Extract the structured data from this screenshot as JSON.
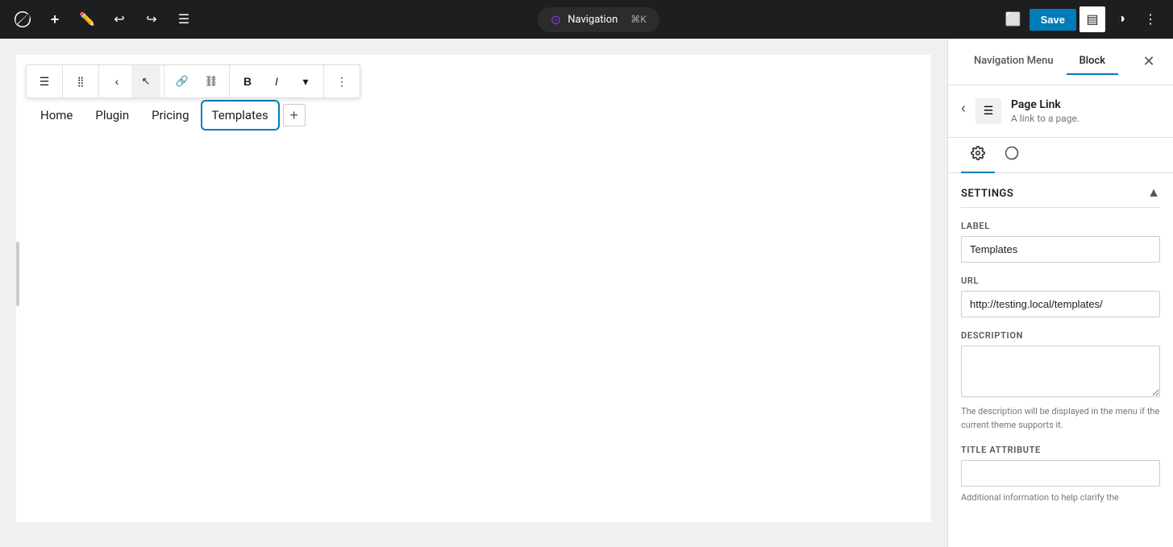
{
  "topbar": {
    "add_label": "+",
    "nav_title": "Navigation",
    "shortcut": "⌘K",
    "save_label": "Save"
  },
  "nav_items": [
    {
      "label": "Home",
      "selected": false
    },
    {
      "label": "Plugin",
      "selected": false
    },
    {
      "label": "Pricing",
      "selected": false
    },
    {
      "label": "Templates",
      "selected": true
    }
  ],
  "sidebar": {
    "nav_menu_tab": "Navigation Menu",
    "block_tab": "Block",
    "block_title": "Page Link",
    "block_desc": "A link to a page.",
    "settings_label": "Settings",
    "label_field_label": "LABEL",
    "label_value": "Templates",
    "url_field_label": "URL",
    "url_value": "http://testing.local/templates/",
    "description_field_label": "DESCRIPTION",
    "description_value": "",
    "description_help": "The description will be displayed in the menu if the current theme supports it.",
    "title_attr_field_label": "TITLE ATTRIBUTE",
    "title_attr_value": "",
    "title_attr_help": "Additional information to help clarify the"
  },
  "toolbar": {
    "list_view": "☰",
    "drag": "⋮⋮",
    "move_left": "←",
    "cursor": "↖",
    "link": "🔗",
    "unlink": "🔗",
    "bold": "B",
    "italic": "I",
    "more": "…",
    "dropdown": "▾"
  }
}
